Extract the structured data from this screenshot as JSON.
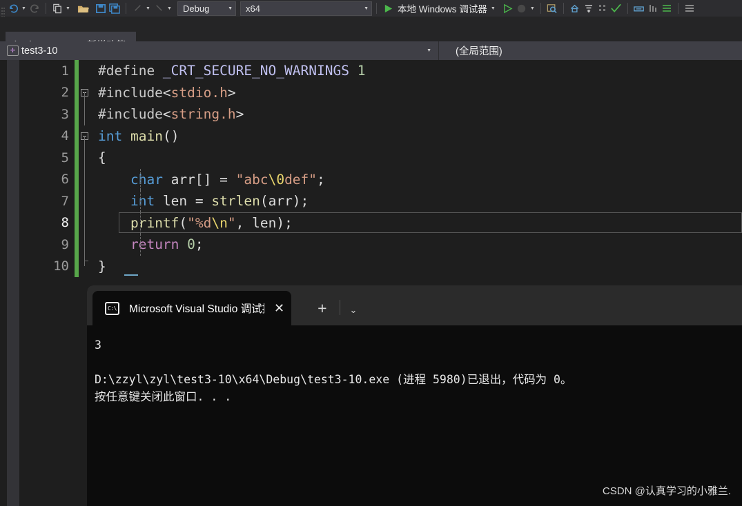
{
  "toolbar": {
    "undo_label": "undo",
    "redo_label": "redo",
    "new_file_label": "new-file",
    "open_label": "open-file",
    "save_label": "save",
    "save_all_label": "save-all",
    "nav_back_label": "navigate-backward",
    "nav_forward_label": "navigate-forward",
    "config_value": "Debug",
    "platform_value": "x64",
    "run_label": "本地 Windows 调试器",
    "search_label": "find",
    "home_label": "home",
    "colors": {
      "accent_blue": "#3d8bcd",
      "folder_yellow": "#d9b26a",
      "run_green": "#4ec04e",
      "save_blue": "#3f8cd0"
    }
  },
  "tabs": [
    {
      "label": "test.c",
      "active": true,
      "pin_icon": "pin-icon",
      "close_icon": "close-icon"
    },
    {
      "label": "新增功能",
      "active": false
    }
  ],
  "navbar": {
    "project_value": "test3-10",
    "project_icon": "vs-project-icon",
    "scope_value": "(全局范围)",
    "caret_icon": "chevron-down-icon"
  },
  "editor": {
    "current_line": 8,
    "colors": {
      "background": "#1e1e1e",
      "keyword": "#569cd6",
      "preprocessor": "#c586c0",
      "string": "#d69d85",
      "escape": "#e8d56c",
      "function": "#dcdcaa",
      "number": "#b5cea8",
      "plain": "#dcdcdc",
      "linenumber": "#9a9a9a",
      "changebar_green": "#57a64a"
    },
    "lines": [
      {
        "n": "1",
        "tokens": [
          {
            "t": "#define ",
            "c": "hdr"
          },
          {
            "t": "_CRT_SECURE_NO_WARNINGS",
            "c": "mac"
          },
          {
            "t": " ",
            "c": "pln"
          },
          {
            "t": "1",
            "c": "num"
          }
        ]
      },
      {
        "n": "2",
        "tokens": [
          {
            "t": "#include",
            "c": "hdr"
          },
          {
            "t": "<",
            "c": "pln"
          },
          {
            "t": "stdio.h",
            "c": "s"
          },
          {
            "t": ">",
            "c": "pln"
          }
        ]
      },
      {
        "n": "3",
        "tokens": [
          {
            "t": "#include",
            "c": "hdr"
          },
          {
            "t": "<",
            "c": "pln"
          },
          {
            "t": "string.h",
            "c": "s"
          },
          {
            "t": ">",
            "c": "pln"
          }
        ]
      },
      {
        "n": "4",
        "tokens": [
          {
            "t": "int",
            "c": "k"
          },
          {
            "t": " ",
            "c": "pln"
          },
          {
            "t": "main",
            "c": "fn"
          },
          {
            "t": "()",
            "c": "pln"
          }
        ]
      },
      {
        "n": "5",
        "tokens": [
          {
            "t": "{",
            "c": "pln"
          }
        ]
      },
      {
        "n": "6",
        "tokens": [
          {
            "t": "    ",
            "c": "pln"
          },
          {
            "t": "char",
            "c": "k"
          },
          {
            "t": " arr[] = ",
            "c": "pln"
          },
          {
            "t": "\"abc",
            "c": "s"
          },
          {
            "t": "\\0",
            "c": "esc"
          },
          {
            "t": "def\"",
            "c": "s"
          },
          {
            "t": ";",
            "c": "pln"
          }
        ]
      },
      {
        "n": "7",
        "tokens": [
          {
            "t": "    ",
            "c": "pln"
          },
          {
            "t": "int",
            "c": "k"
          },
          {
            "t": " len = ",
            "c": "pln"
          },
          {
            "t": "strlen",
            "c": "fn"
          },
          {
            "t": "(arr);",
            "c": "pln"
          }
        ]
      },
      {
        "n": "8",
        "tokens": [
          {
            "t": "    ",
            "c": "pln"
          },
          {
            "t": "printf",
            "c": "fn"
          },
          {
            "t": "(",
            "c": "pln"
          },
          {
            "t": "\"%d",
            "c": "s"
          },
          {
            "t": "\\n",
            "c": "esc"
          },
          {
            "t": "\"",
            "c": "s"
          },
          {
            "t": ", len);",
            "c": "pln"
          }
        ]
      },
      {
        "n": "9",
        "tokens": [
          {
            "t": "    ",
            "c": "pln"
          },
          {
            "t": "return",
            "c": "kp"
          },
          {
            "t": " ",
            "c": "pln"
          },
          {
            "t": "0",
            "c": "num"
          },
          {
            "t": ";",
            "c": "pln"
          }
        ]
      },
      {
        "n": "10",
        "tokens": [
          {
            "t": "}",
            "c": "pln"
          }
        ]
      }
    ]
  },
  "console": {
    "tab_title": "Microsoft Visual Studio 调试控制台",
    "tab_icon": "cmd-prompt-icon",
    "close_icon": "close-icon",
    "new_tab_icon": "plus-icon",
    "dropdown_icon": "chevron-down-icon",
    "output": "3\n\nD:\\zzyl\\zyl\\test3-10\\x64\\Debug\\test3-10.exe (进程 5980)已退出，代码为 0。\n按任意键关闭此窗口. . ."
  },
  "watermark": {
    "text": "CSDN @认真学习的小雅兰."
  }
}
